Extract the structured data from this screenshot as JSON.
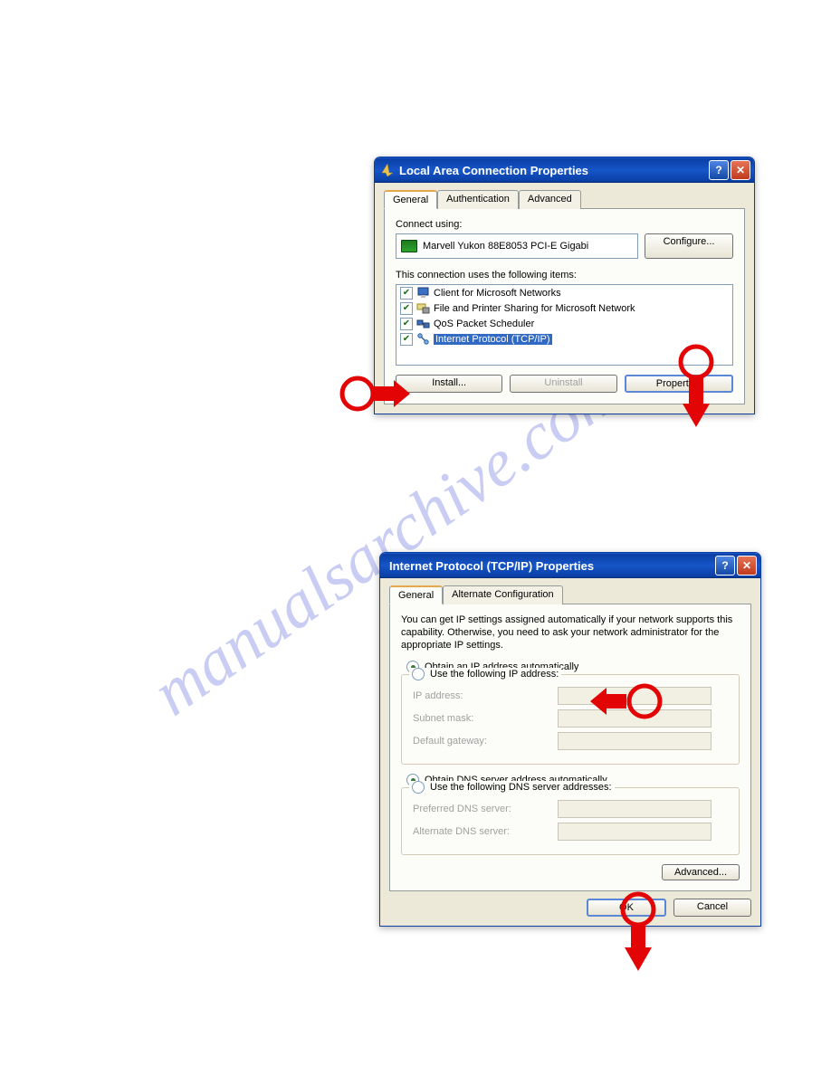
{
  "watermark": "manualsarchive.com",
  "dialog1": {
    "title": "Local Area Connection Properties",
    "tabs": [
      "General",
      "Authentication",
      "Advanced"
    ],
    "connectUsingLabel": "Connect using:",
    "adapterName": "Marvell Yukon 88E8053 PCI-E Gigabi",
    "configureBtn": "Configure...",
    "itemsLabel": "This connection uses the following items:",
    "items": [
      "Client for Microsoft Networks",
      "File and Printer Sharing for Microsoft Network",
      "QoS Packet Scheduler",
      "Internet Protocol (TCP/IP)"
    ],
    "installBtn": "Install...",
    "uninstallBtn": "Uninstall",
    "propertiesBtn": "Properties"
  },
  "dialog2": {
    "title": "Internet Protocol (TCP/IP) Properties",
    "tabs": [
      "General",
      "Alternate Configuration"
    ],
    "description": "You can get IP settings assigned automatically if your network supports this capability. Otherwise, you need to ask your network administrator for the appropriate IP settings.",
    "radioObtainIP": "Obtain an IP address automatically",
    "radioUseIP": "Use the following IP address:",
    "ipAddressLabel": "IP address:",
    "subnetLabel": "Subnet mask:",
    "gatewayLabel": "Default gateway:",
    "radioObtainDNS": "Obtain DNS server address automatically",
    "radioUseDNS": "Use the following DNS server addresses:",
    "prefDnsLabel": "Preferred DNS server:",
    "altDnsLabel": "Alternate DNS server:",
    "advancedBtn": "Advanced...",
    "okBtn": "OK",
    "cancelBtn": "Cancel"
  }
}
